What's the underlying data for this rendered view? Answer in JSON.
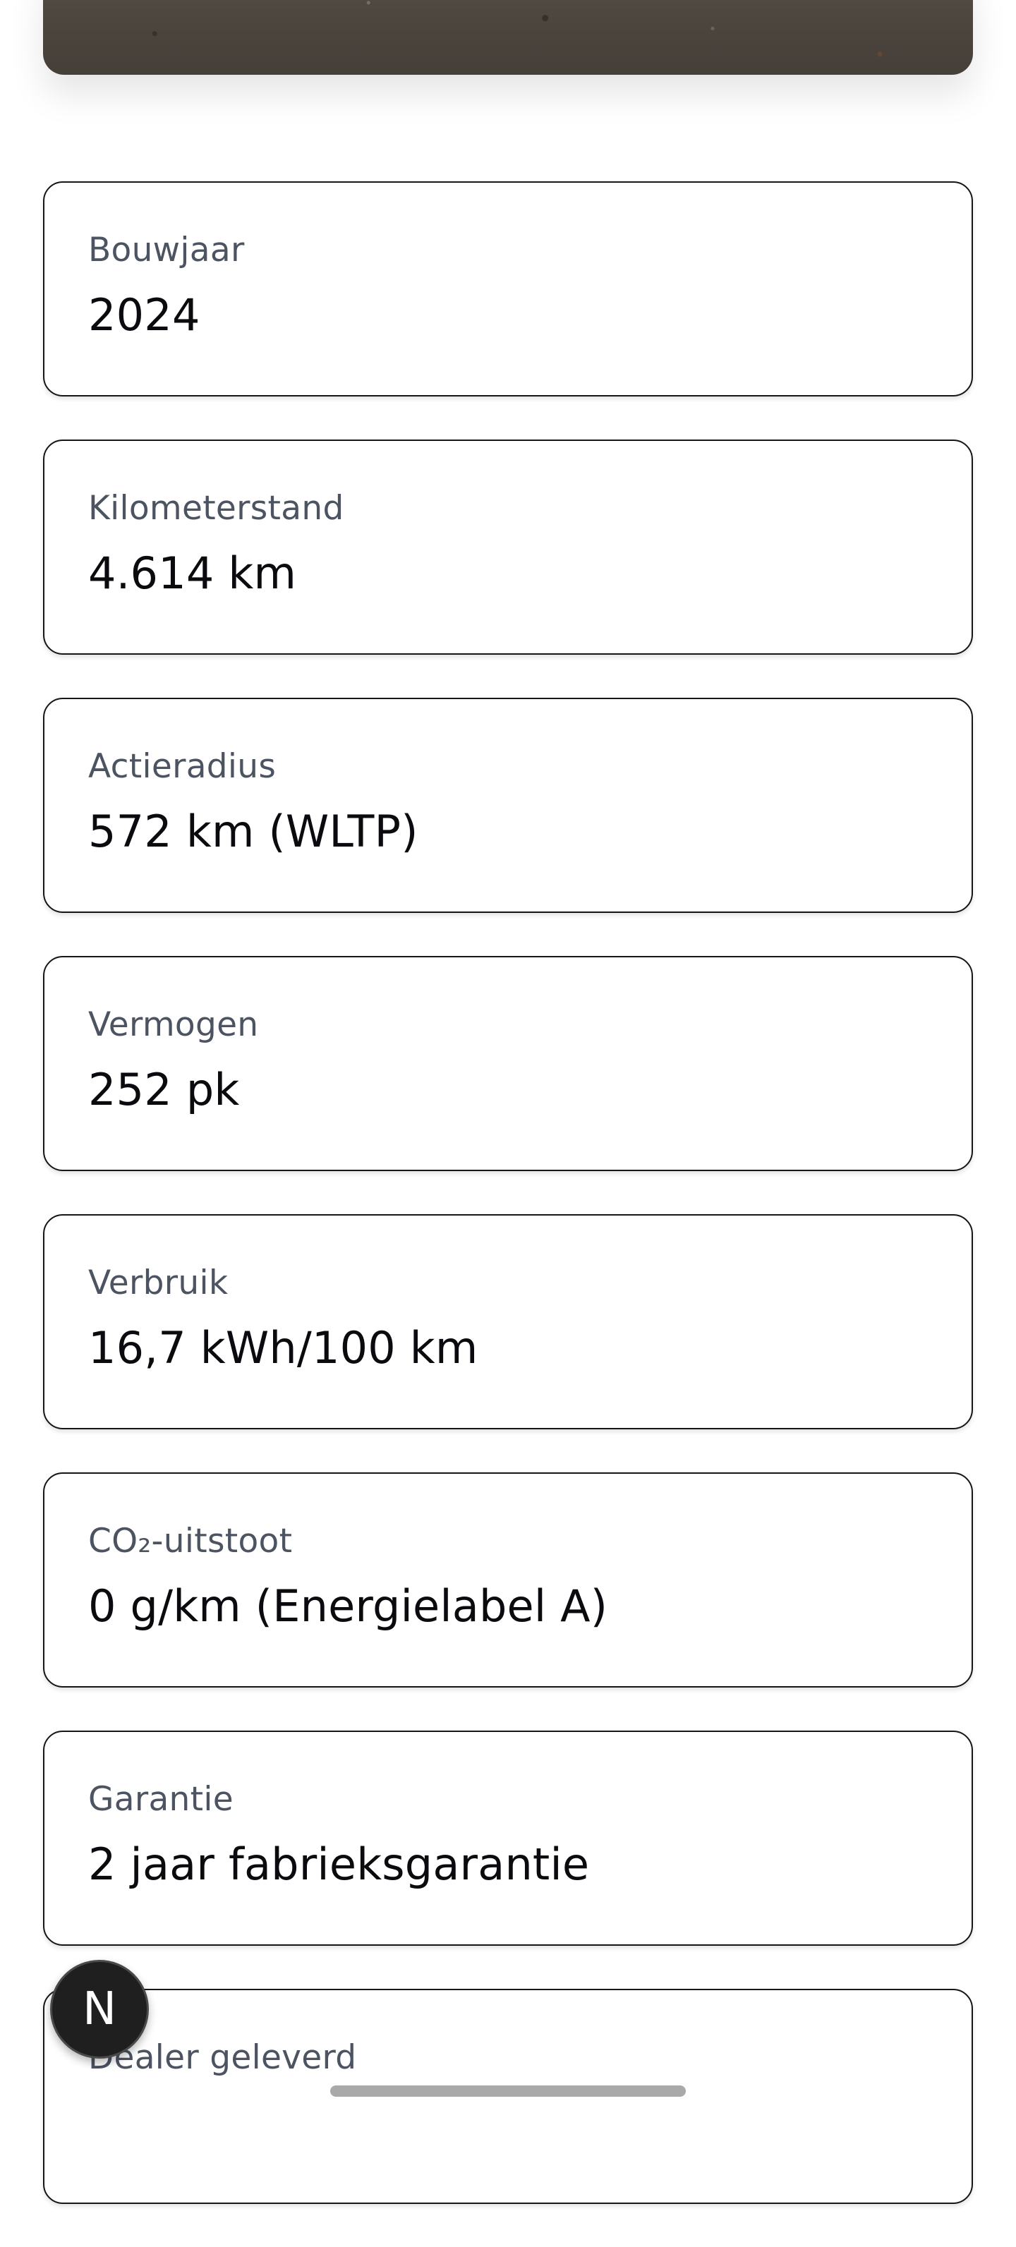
{
  "specs": [
    {
      "label": "Bouwjaar",
      "value": "2024"
    },
    {
      "label": "Kilometerstand",
      "value": "4.614 km"
    },
    {
      "label": "Actieradius",
      "value": "572 km (WLTP)"
    },
    {
      "label": "Vermogen",
      "value": "252 pk"
    },
    {
      "label": "Verbruik",
      "value": "16,7 kWh/100 km"
    },
    {
      "label": "CO₂-uitstoot",
      "value": "0 g/km (Energielabel A)"
    },
    {
      "label": "Garantie",
      "value": "2 jaar fabrieksgarantie"
    },
    {
      "label": "Dealer geleverd",
      "value": ""
    }
  ],
  "fab": {
    "letter": "N",
    "icon": "n-logo-icon"
  },
  "colors": {
    "card_border": "#16161a",
    "label_text": "#4c5361",
    "value_text": "#0b0b0f",
    "fab_background": "#1f1f1f",
    "home_indicator": "#a9a9a9"
  }
}
